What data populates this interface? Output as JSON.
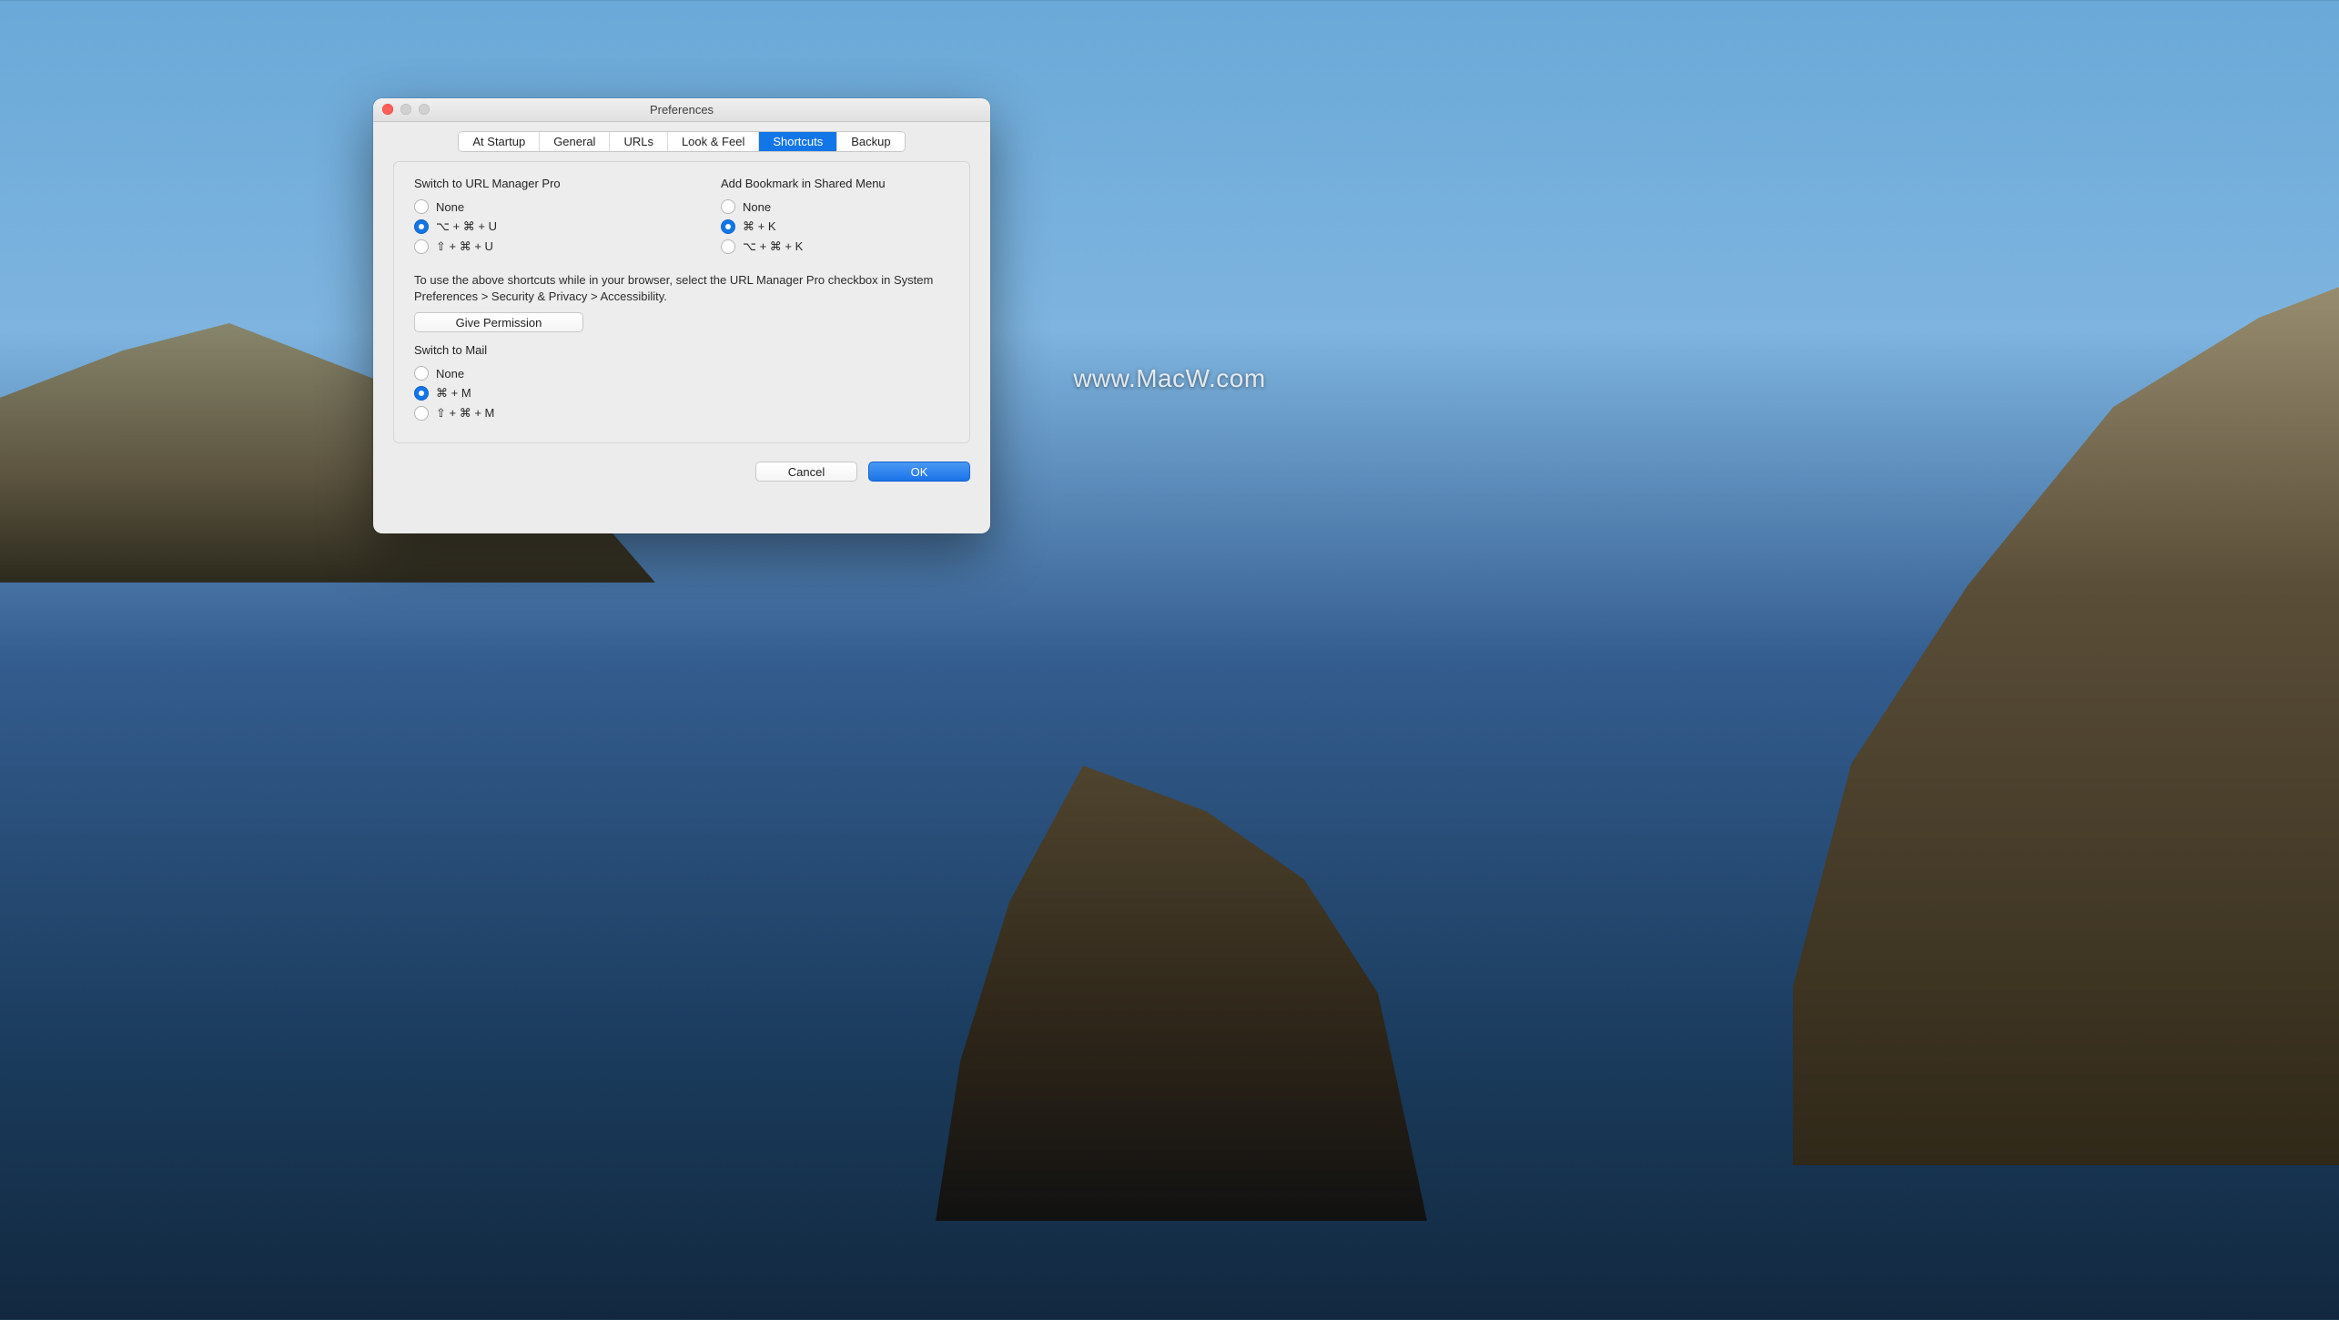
{
  "window": {
    "title": "Preferences",
    "tabs": [
      "At Startup",
      "General",
      "URLs",
      "Look & Feel",
      "Shortcuts",
      "Backup"
    ],
    "active_tab_index": 4
  },
  "sections": {
    "switch_to_ump": {
      "title": "Switch to URL Manager Pro",
      "options": [
        "None",
        "⌥ + ⌘ + U",
        "⇧ + ⌘ + U"
      ],
      "selected_index": 1
    },
    "add_bookmark": {
      "title": "Add Bookmark in Shared Menu",
      "options": [
        "None",
        "⌘ + K",
        "⌥ + ⌘ + K"
      ],
      "selected_index": 1
    },
    "info_text": "To use the above shortcuts while in your browser, select the URL Manager Pro checkbox in System Preferences > Security & Privacy > Accessibility.",
    "give_permission": "Give Permission",
    "switch_to_mail": {
      "title": "Switch to Mail",
      "options": [
        "None",
        "⌘ + M",
        "⇧ + ⌘ + M"
      ],
      "selected_index": 1
    }
  },
  "buttons": {
    "cancel": "Cancel",
    "ok": "OK"
  },
  "watermark": "www.MacW.com"
}
